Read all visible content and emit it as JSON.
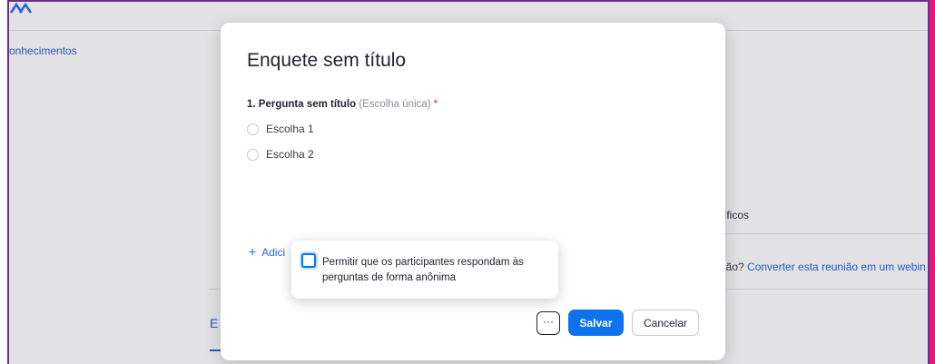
{
  "background": {
    "sidebar_link": "onhecimentos",
    "text_specific": "íficos",
    "convert_prefix": "ião? ",
    "convert_link": "Converter esta reunião em um webin",
    "tab_fragment": "E"
  },
  "modal": {
    "title": "Enquete sem título",
    "question": {
      "label": "1. Pergunta sem título",
      "type": " (Escolha única)",
      "required_mark": " *"
    },
    "choices": [
      "Escolha 1",
      "Escolha 2"
    ],
    "add_question": "Adici",
    "more_label": "···",
    "save_label": "Salvar",
    "cancel_label": "Cancelar"
  },
  "popover": {
    "checkbox_checked": false,
    "text": "Permitir que os participantes respondam às perguntas de forma anônima"
  },
  "colors": {
    "accent": "#0e72ed",
    "link": "#2c65d9",
    "required": "#e02828",
    "frame": "#6e2d8c",
    "edge_strip": "#e2197b"
  },
  "icons": {
    "add": "plus-icon",
    "more": "more-dots-icon",
    "logo": "zoom-logo-icon"
  }
}
